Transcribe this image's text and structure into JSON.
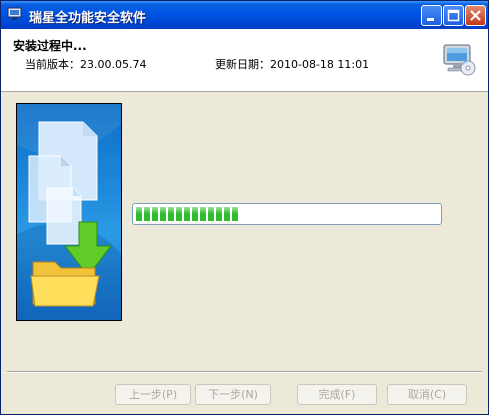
{
  "window": {
    "title": "瑞星全功能安全软件"
  },
  "header": {
    "title": "安装过程中...",
    "version_label": "当前版本：23.00.05.74",
    "date_label": "更新日期：2010-08-18 11:01"
  },
  "progress": {
    "fraction": 0.34
  },
  "buttons": {
    "back": "上一步(P)",
    "next": "下一步(N)",
    "finish": "完成(F)",
    "cancel": "取消(C)"
  },
  "icons": {
    "app": "computer-icon",
    "header": "monitor-disc-icon",
    "banner": "install-documents-to-folder-illustration"
  },
  "colors": {
    "titlebar": "#0054e3",
    "progress": "#2fbd2f",
    "dialog_bg": "#ece9d8"
  }
}
